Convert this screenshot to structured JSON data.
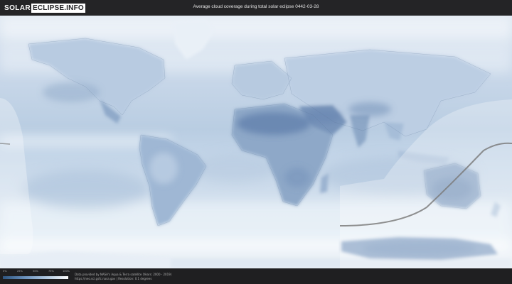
{
  "header": {
    "logo_word": "SOLAR",
    "logo_box": "ECLIPSE.INFO",
    "title": "Average cloud coverage during total solar eclipse 0442-03-28"
  },
  "map": {
    "map_type": "cloud-coverage world map with eclipse path overlay",
    "colors": {
      "ocean_cloud": "#c9d9ea",
      "clear_land": "#6f8fb8",
      "cloudy": "#f4f8fb",
      "eclipse_path": "#8a8a8a"
    }
  },
  "legend": {
    "ticks": [
      "0%",
      "25%",
      "50%",
      "75%",
      "100%"
    ],
    "gradient_colors": [
      "#2e5580",
      "#6d93be",
      "#b8cde2",
      "#ffffff"
    ]
  },
  "footer": {
    "credit_line1": "Data provided by NASA's Aqua & Terra satellite (Years: 2000 - 2019)",
    "credit_line2": "https://neo.sci.gsfc.nasa.gov | Resolution: 0.1 degrees"
  }
}
